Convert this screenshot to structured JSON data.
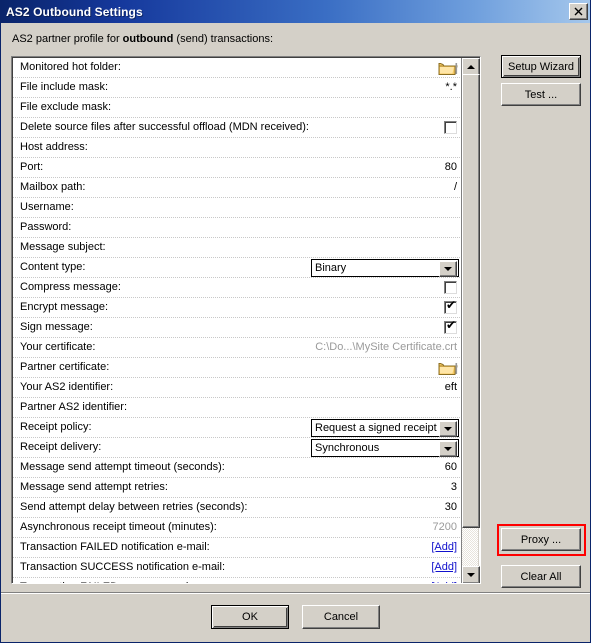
{
  "window": {
    "title": "AS2 Outbound Settings",
    "close_label": "✕",
    "subtitle_prefix": "AS2 partner profile for ",
    "subtitle_bold": "outbound",
    "subtitle_suffix": " (send) transactions:"
  },
  "colors": {
    "title_start": "#0a246a",
    "title_end": "#a6c8ec",
    "link": "#1111cc",
    "disabled_text": "#9a9a9a",
    "highlight": "#ff0000",
    "dialog_face": "#d4d0c8"
  },
  "grid": {
    "rows": [
      {
        "label": "Monitored hot folder:",
        "value": "",
        "kind": "folder"
      },
      {
        "label": "File include mask:",
        "value": "*.*",
        "kind": "text"
      },
      {
        "label": "File exclude mask:",
        "value": "",
        "kind": "text"
      },
      {
        "label": "Delete source files after successful offload (MDN received):",
        "value": "",
        "kind": "checkbox",
        "checked": false
      },
      {
        "label": "Host address:",
        "value": "",
        "kind": "text"
      },
      {
        "label": "Port:",
        "value": "80",
        "kind": "text"
      },
      {
        "label": "Mailbox path:",
        "value": "/",
        "kind": "text"
      },
      {
        "label": "Username:",
        "value": "",
        "kind": "text"
      },
      {
        "label": "Password:",
        "value": "",
        "kind": "text"
      },
      {
        "label": "Message subject:",
        "value": "",
        "kind": "text"
      },
      {
        "label": "Content type:",
        "value": "Binary",
        "kind": "combo"
      },
      {
        "label": "Compress message:",
        "value": "",
        "kind": "checkbox",
        "checked": false
      },
      {
        "label": "Encrypt message:",
        "value": "",
        "kind": "checkbox",
        "checked": true
      },
      {
        "label": "Sign message:",
        "value": "",
        "kind": "checkbox",
        "checked": true
      },
      {
        "label": "Your certificate:",
        "value": "C:\\Do...\\MySite Certificate.crt",
        "kind": "text",
        "disabled": true
      },
      {
        "label": "Partner certificate:",
        "value": "",
        "kind": "folder"
      },
      {
        "label": "Your AS2 identifier:",
        "value": "eft",
        "kind": "text"
      },
      {
        "label": "Partner AS2 identifier:",
        "value": "",
        "kind": "text"
      },
      {
        "label": "Receipt policy:",
        "value": "Request a signed receipt",
        "kind": "combo"
      },
      {
        "label": "Receipt delivery:",
        "value": "Synchronous",
        "kind": "combo"
      },
      {
        "label": "Message send attempt timeout (seconds):",
        "value": "60",
        "kind": "text"
      },
      {
        "label": "Message send attempt retries:",
        "value": "3",
        "kind": "text"
      },
      {
        "label": "Send attempt delay between retries (seconds):",
        "value": "30",
        "kind": "text"
      },
      {
        "label": "Asynchronous receipt timeout (minutes):",
        "value": "7200",
        "kind": "text",
        "disabled": true
      },
      {
        "label": "Transaction FAILED notification e-mail:",
        "value": "[Add]",
        "kind": "link"
      },
      {
        "label": "Transaction SUCCESS notification e-mail:",
        "value": "[Add]",
        "kind": "link"
      },
      {
        "label": "Transaction FAILED run command:",
        "value": "[Add]",
        "kind": "link"
      }
    ]
  },
  "scrollbar": {
    "up_icon": "scroll-up-icon",
    "down_icon": "scroll-down-icon"
  },
  "buttons": {
    "setup_wizard": "Setup Wizard",
    "test": "Test ...",
    "proxy": "Proxy ...",
    "clear_all": "Clear All",
    "ok": "OK",
    "cancel": "Cancel"
  }
}
